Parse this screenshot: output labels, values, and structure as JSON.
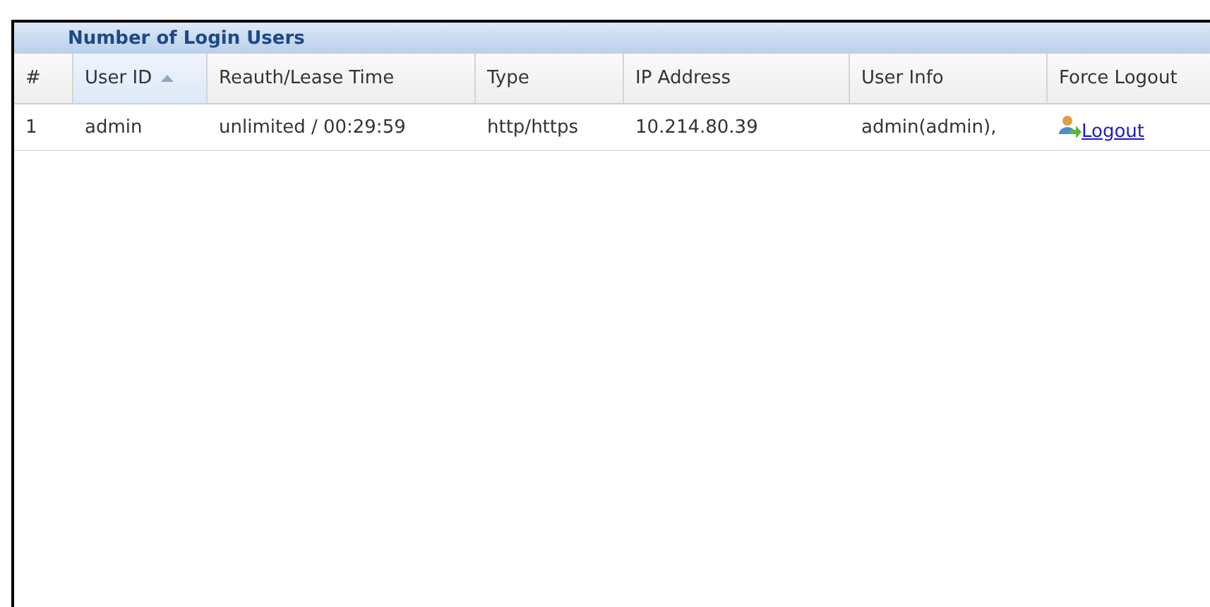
{
  "panel": {
    "title": "Number of Login Users"
  },
  "table": {
    "columns": [
      {
        "label": "#",
        "sorted": false
      },
      {
        "label": "User ID",
        "sorted": true
      },
      {
        "label": "Reauth/Lease Time",
        "sorted": false
      },
      {
        "label": "Type",
        "sorted": false
      },
      {
        "label": "IP Address",
        "sorted": false
      },
      {
        "label": "User Info",
        "sorted": false
      },
      {
        "label": "Force Logout",
        "sorted": false
      }
    ],
    "rows": [
      {
        "cells": [
          "1",
          "admin",
          "unlimited / 00:29:59",
          "http/https",
          "10.214.80.39",
          "admin(admin),"
        ],
        "action": "Logout"
      }
    ]
  }
}
